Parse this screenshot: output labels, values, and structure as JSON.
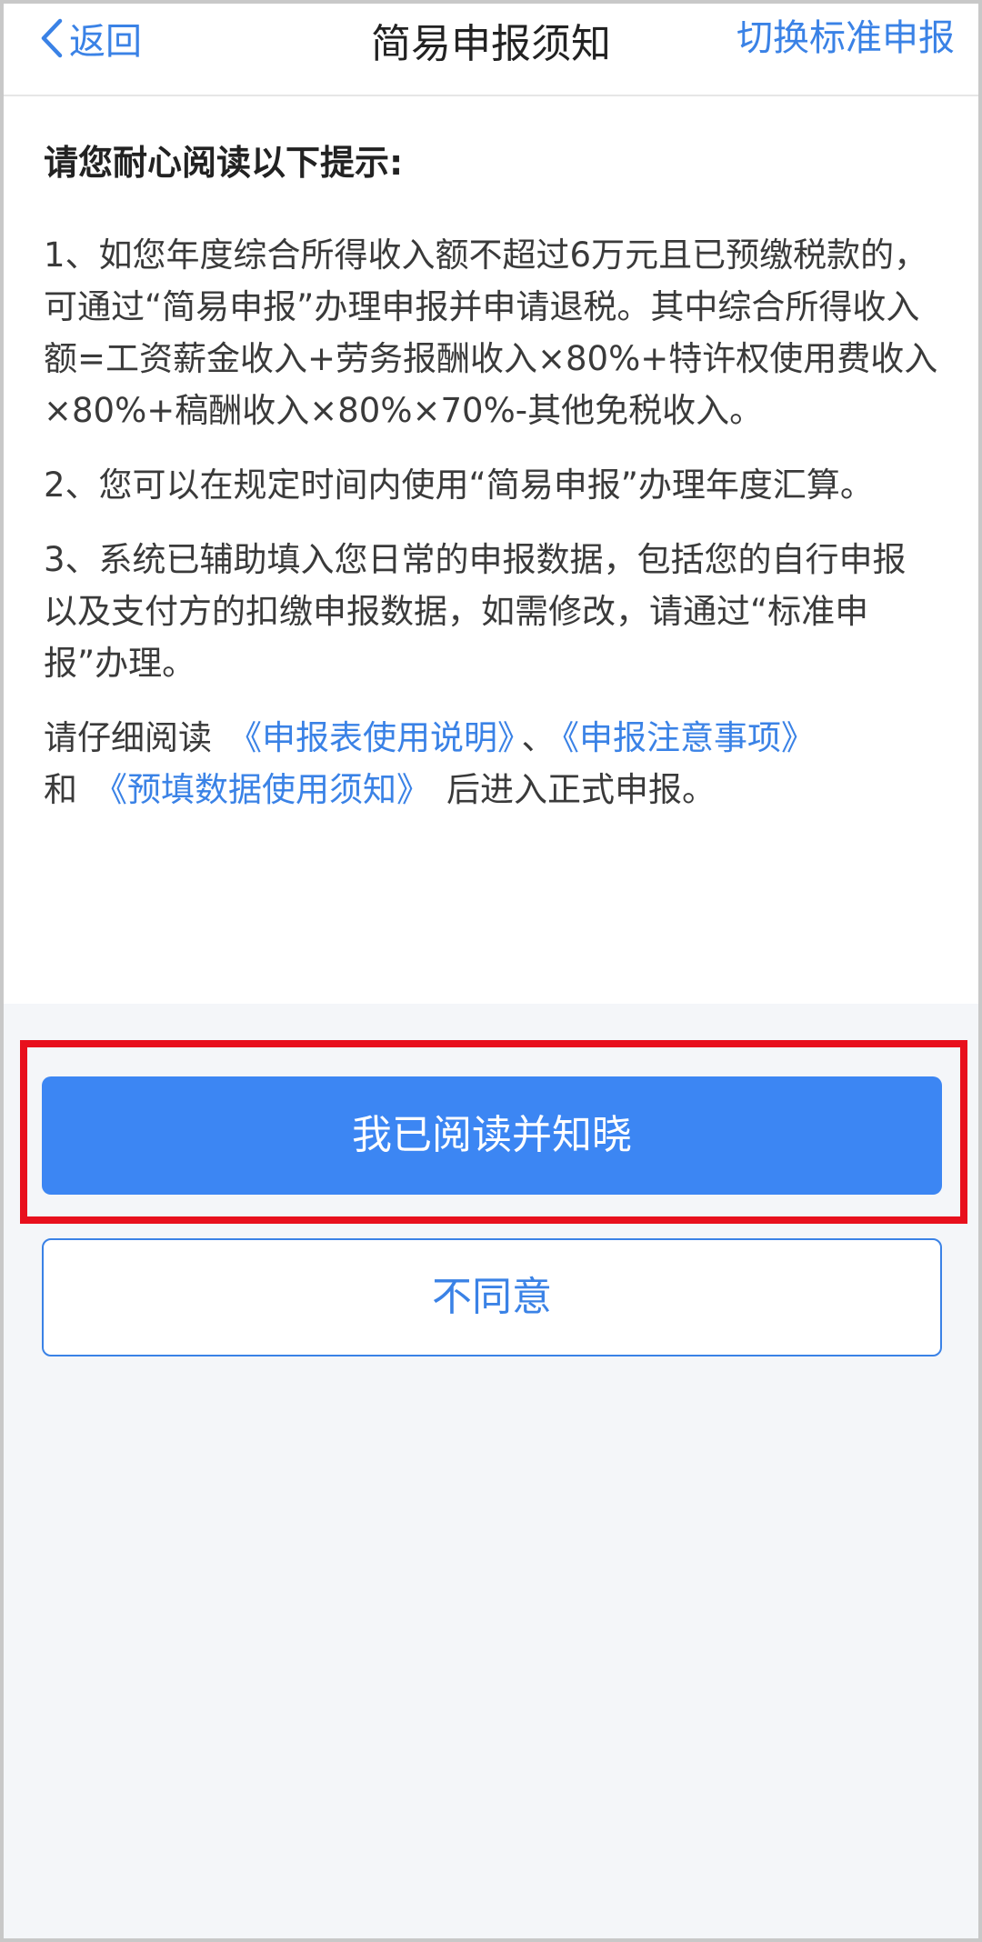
{
  "nav": {
    "back_label": "返回",
    "title": "简易申报须知",
    "switch_label": "切换标准申报"
  },
  "notice": {
    "heading": "请您耐心阅读以下提示:",
    "items": [
      "1、如您年度综合所得收入额不超过6万元且已预缴税款的，可通过“简易申报”办理申报并申请退税。其中综合所得收入额=工资薪金收入+劳务报酬收入×80%+特许权使用费收入×80%+稿酬收入×80%×70%-其他免税收入。",
      "2、您可以在规定时间内使用“简易申报”办理年度汇算。",
      "3、系统已辅助填入您日常的申报数据，包括您的自行申报以及支付方的扣缴申报数据，如需修改，请通过“标准申报”办理。"
    ],
    "links_line": {
      "prefix": "请仔细阅读",
      "link1": "《申报表使用说明》",
      "separator": "、",
      "link2": "《申报注意事项》",
      "and": "和",
      "link3": "《预填数据使用须知》",
      "suffix": "后进入正式申报。"
    }
  },
  "actions": {
    "agree_label": "我已阅读并知晓",
    "disagree_label": "不同意"
  },
  "colors": {
    "accent": "#3a82e6",
    "primary_button": "#3c86f3",
    "highlight_box": "#e8101d"
  }
}
